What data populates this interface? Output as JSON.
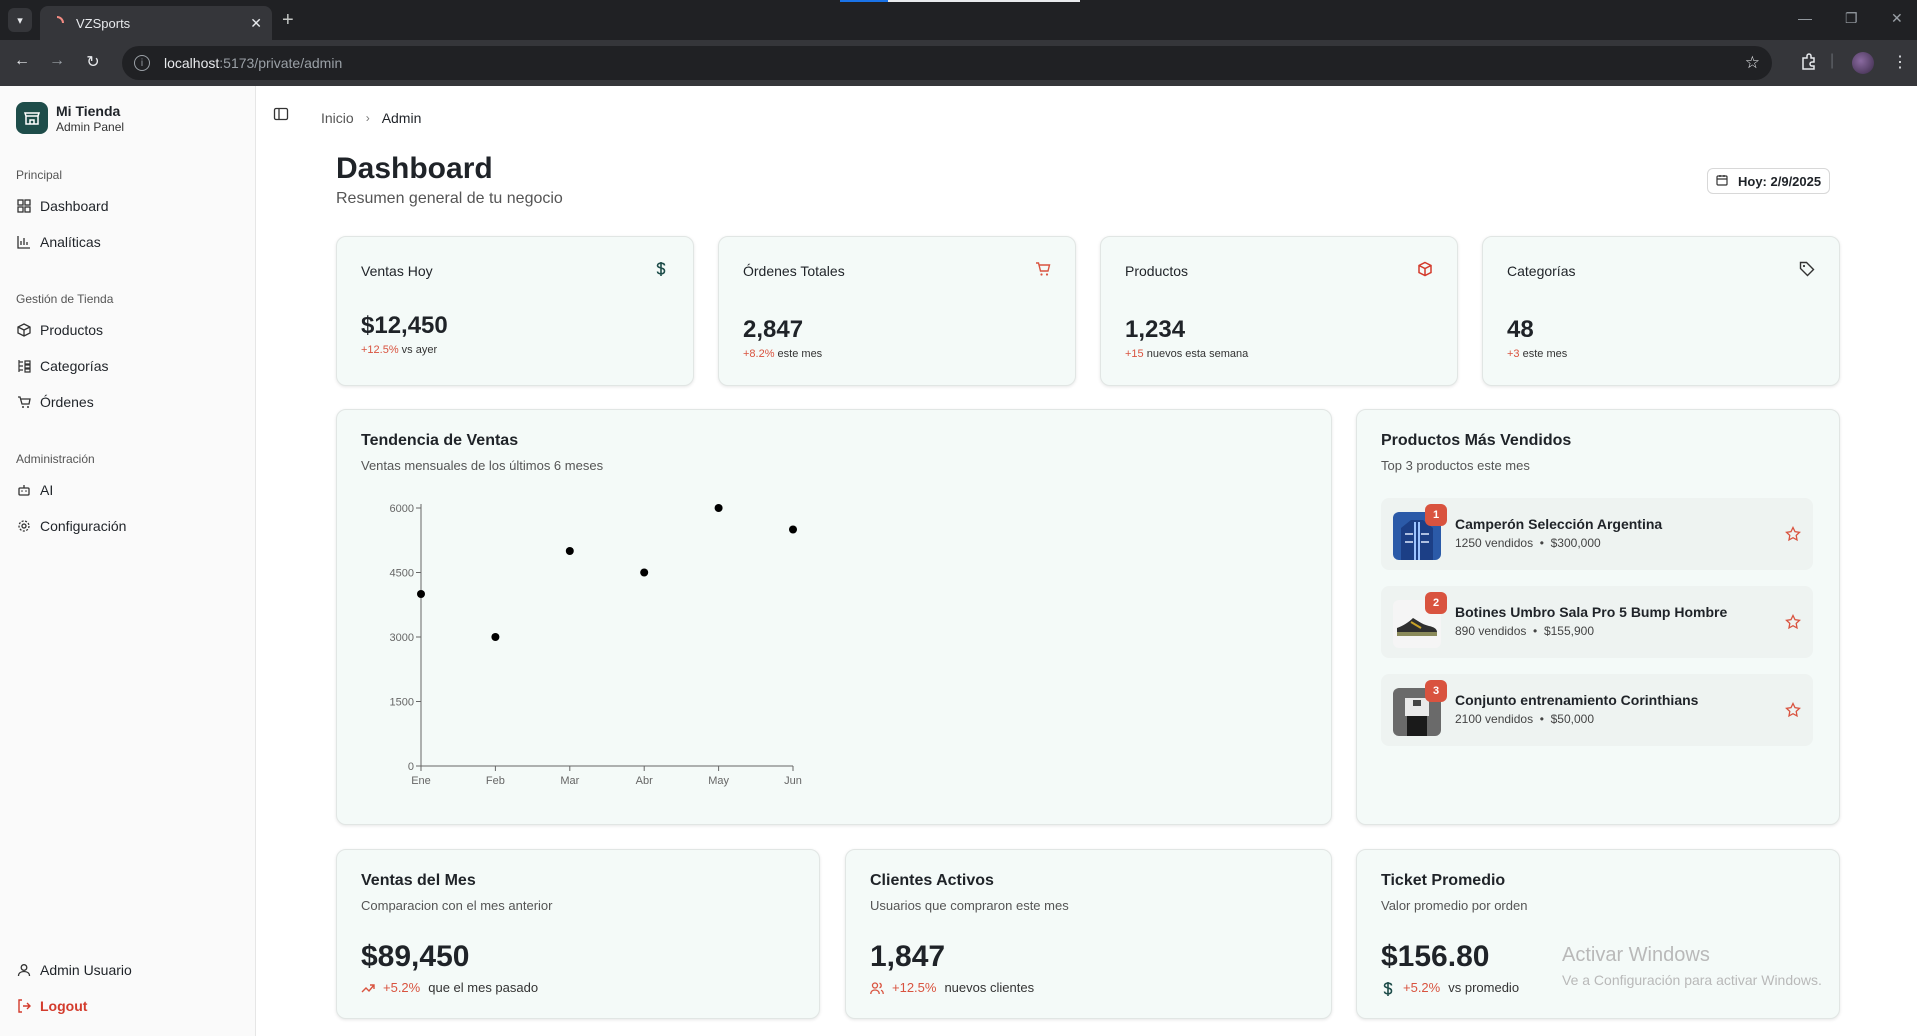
{
  "browser": {
    "tab_title": "VZSports",
    "url_host": "localhost",
    "url_path": ":5173/private/admin"
  },
  "sidebar": {
    "brand_name": "Mi Tienda",
    "brand_sub": "Admin Panel",
    "groups": [
      {
        "label": "Principal",
        "items": [
          {
            "label": "Dashboard",
            "icon": "grid-icon"
          },
          {
            "label": "Analíticas",
            "icon": "bar-chart-icon"
          }
        ]
      },
      {
        "label": "Gestión de Tienda",
        "items": [
          {
            "label": "Productos",
            "icon": "box-icon"
          },
          {
            "label": "Categorías",
            "icon": "list-icon"
          },
          {
            "label": "Órdenes",
            "icon": "cart-icon"
          }
        ]
      },
      {
        "label": "Administración",
        "items": [
          {
            "label": "AI",
            "icon": "bot-icon"
          },
          {
            "label": "Configuración",
            "icon": "gear-icon"
          }
        ]
      }
    ],
    "user_label": "Admin Usuario",
    "logout_label": "Logout"
  },
  "breadcrumb": {
    "home": "Inicio",
    "current": "Admin"
  },
  "header": {
    "title": "Dashboard",
    "subtitle": "Resumen general de tu negocio",
    "date_label": "Hoy: 2/9/2025"
  },
  "stats": [
    {
      "title": "Ventas Hoy",
      "value": "$12,450",
      "change": "+12.5%",
      "change_text": " vs ayer",
      "icon": "dollar-icon",
      "icon_color": "#1e4d4a"
    },
    {
      "title": "Órdenes Totales",
      "value": "2,847",
      "change": "+8.2%",
      "change_text": " este mes",
      "icon": "cart-icon",
      "icon_color": "#d9533f"
    },
    {
      "title": "Productos",
      "value": "1,234",
      "change": "+15",
      "change_text": " nuevos esta semana",
      "icon": "box-icon",
      "icon_color": "#d33b2c"
    },
    {
      "title": "Categorías",
      "value": "48",
      "change": "+3",
      "change_text": " este mes",
      "icon": "tag-icon",
      "icon_color": "#333333"
    }
  ],
  "sales_chart": {
    "title": "Tendencia de Ventas",
    "subtitle": "Ventas mensuales de los últimos 6 meses"
  },
  "chart_data": {
    "type": "scatter",
    "categories": [
      "Ene",
      "Feb",
      "Mar",
      "Abr",
      "May",
      "Jun"
    ],
    "values": [
      4000,
      3000,
      5000,
      4500,
      6000,
      5500
    ],
    "ylim": [
      0,
      6000
    ],
    "yticks": [
      0,
      1500,
      3000,
      4500,
      6000
    ],
    "title": "",
    "xlabel": "",
    "ylabel": "",
    "grid": false
  },
  "top_products": {
    "title": "Productos Más Vendidos",
    "subtitle": "Top 3 productos este mes",
    "items": [
      {
        "rank": "1",
        "name": "Camperón Selección Argentina",
        "sold": "1250 vendidos",
        "revenue": "$300,000"
      },
      {
        "rank": "2",
        "name": "Botines Umbro Sala Pro 5 Bump Hombre",
        "sold": "890 vendidos",
        "revenue": "$155,900"
      },
      {
        "rank": "3",
        "name": "Conjunto entrenamiento Corinthians",
        "sold": "2100 vendidos",
        "revenue": "$50,000"
      }
    ]
  },
  "bottom_cards": [
    {
      "title": "Ventas del Mes",
      "subtitle": "Comparacion con el mes anterior",
      "value": "$89,450",
      "change": "+5.2%",
      "change_text": "que el mes pasado",
      "icon": "trending-up-icon"
    },
    {
      "title": "Clientes Activos",
      "subtitle": "Usuarios que compraron este mes",
      "value": "1,847",
      "change": "+12.5%",
      "change_text": "nuevos clientes",
      "icon": "users-icon"
    },
    {
      "title": "Ticket Promedio",
      "subtitle": "Valor promedio por orden",
      "value": "$156.80",
      "change": "+5.2%",
      "change_text": "vs promedio",
      "icon": "dollar-icon"
    }
  ],
  "watermark": {
    "title": "Activar Windows",
    "subtitle": "Ve a Configuración para activar Windows."
  },
  "colors": {
    "accent": "#d9533f",
    "brand": "#1e4d4a",
    "card_bg": "#f4faf8"
  }
}
